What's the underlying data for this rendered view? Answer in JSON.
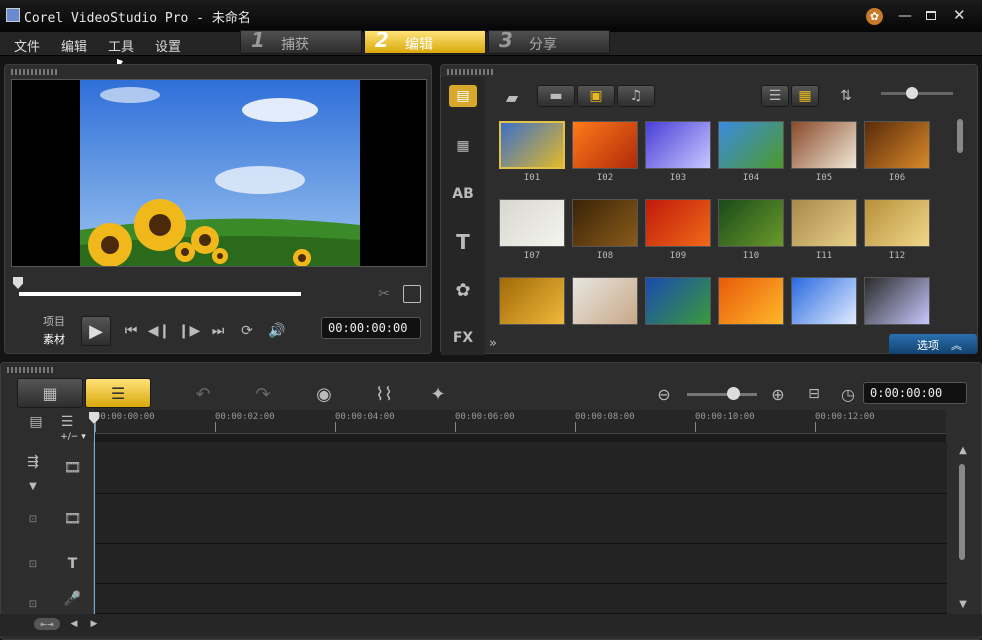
{
  "window": {
    "title": "Corel VideoStudio Pro - 未命名"
  },
  "menu": [
    "文件",
    "编辑",
    "工具",
    "设置"
  ],
  "steps": [
    {
      "num": "1",
      "label": "捕获"
    },
    {
      "num": "2",
      "label": "编辑"
    },
    {
      "num": "3",
      "label": "分享"
    }
  ],
  "player": {
    "mode_project": "项目",
    "mode_clip": "素材",
    "timecode": "00:00:00:00"
  },
  "library": {
    "thumbs": [
      {
        "label": "I01",
        "c1": "#3b6fc9",
        "c2": "#e2b92a"
      },
      {
        "label": "I02",
        "c1": "#ff7a1a",
        "c2": "#b02a0a"
      },
      {
        "label": "I03",
        "c1": "#4a3fd8",
        "c2": "#c8c8ff"
      },
      {
        "label": "I04",
        "c1": "#3b8be0",
        "c2": "#4d9a2a"
      },
      {
        "label": "I05",
        "c1": "#8a4a2a",
        "c2": "#f0e8d8"
      },
      {
        "label": "I06",
        "c1": "#5a2a0a",
        "c2": "#d88a2a"
      },
      {
        "label": "I07",
        "c1": "#d8d8d0",
        "c2": "#f4f4ee"
      },
      {
        "label": "I08",
        "c1": "#3a2408",
        "c2": "#8a5a1a"
      },
      {
        "label": "I09",
        "c1": "#c01a0a",
        "c2": "#f06a1a"
      },
      {
        "label": "I10",
        "c1": "#1a4a1a",
        "c2": "#6a9a2a"
      },
      {
        "label": "I11",
        "c1": "#a88a4a",
        "c2": "#e8d08a"
      },
      {
        "label": "I12",
        "c1": "#b8903a",
        "c2": "#f0d88a"
      },
      {
        "label": "",
        "c1": "#a06a08",
        "c2": "#f0b83a"
      },
      {
        "label": "",
        "c1": "#e8e6e0",
        "c2": "#c8a888"
      },
      {
        "label": "",
        "c1": "#1a4ab0",
        "c2": "#3a9a3a"
      },
      {
        "label": "",
        "c1": "#e85a0a",
        "c2": "#ffb82a"
      },
      {
        "label": "",
        "c1": "#2a6ae0",
        "c2": "#e0ecff"
      },
      {
        "label": "",
        "c1": "#2a2a2a",
        "c2": "#c8c8ff"
      }
    ],
    "options_label": "选项"
  },
  "timeline": {
    "timecode": "0:00:00:00",
    "ruler": [
      "00:00:00:00",
      "00:00:02:00",
      "00:00:04:00",
      "00:00:06:00",
      "00:00:08:00",
      "00:00:10:00",
      "00:00:12:00"
    ],
    "add_remove": "+/−"
  },
  "colors": {
    "accent": "#e8b820"
  }
}
